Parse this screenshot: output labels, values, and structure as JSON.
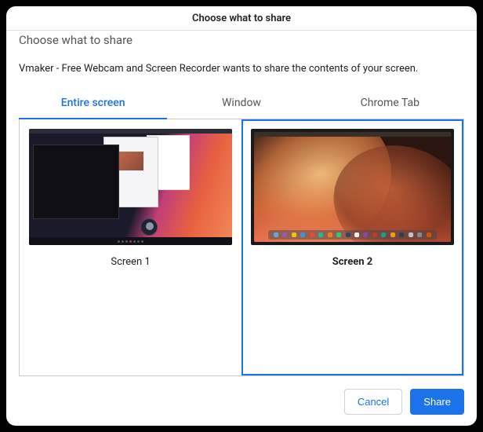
{
  "window": {
    "title": "Choose what to share"
  },
  "heading_cut": "Choose what to share",
  "description": "Vmaker - Free Webcam and Screen Recorder wants to share the contents of your screen.",
  "tabs": [
    {
      "label": "Entire screen",
      "active": true
    },
    {
      "label": "Window",
      "active": false
    },
    {
      "label": "Chrome Tab",
      "active": false
    }
  ],
  "screens": [
    {
      "label": "Screen 1",
      "selected": false
    },
    {
      "label": "Screen 2",
      "selected": true
    }
  ],
  "buttons": {
    "cancel": "Cancel",
    "share": "Share"
  }
}
